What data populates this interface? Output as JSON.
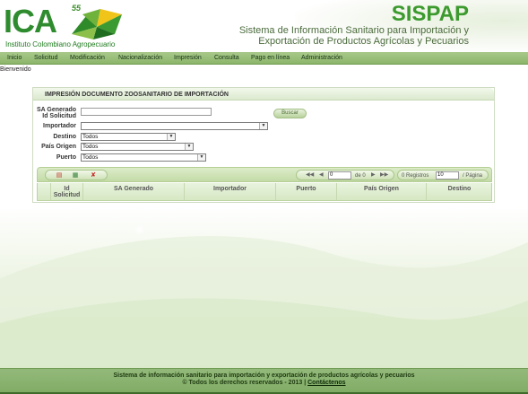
{
  "header": {
    "logo_text": "ICA",
    "logo_badge": "55",
    "org_name": "Instituto Colombiano Agropecuario",
    "app_name": "SISPAP",
    "app_title_line1": "Sistema de Información Sanitario para Importación y",
    "app_title_line2": "Exportación de Productos Agrícolas y Pecuarios"
  },
  "menu": {
    "items": [
      "Inicio",
      "Solicitud",
      "Modificación",
      "Nacionalización",
      "Impresión",
      "Consulta",
      "Pago en línea",
      "Administración"
    ]
  },
  "welcome": "Bienvenido",
  "panel": {
    "title": "IMPRESIÓN DOCUMENTO ZOOSANITARIO DE IMPORTACIÓN",
    "fields": {
      "sa_label_line1": "SA Generado",
      "sa_label_line2": "Id Solicitud",
      "sa_value": "",
      "importador_label": "Importador",
      "importador_value": "",
      "destino_label": "Destino",
      "destino_value": "Todos",
      "pais_label": "País Origen",
      "pais_value": "Todos",
      "puerto_label": "Puerto",
      "puerto_value": "Todos"
    },
    "buscar_label": "Buscar",
    "pager": {
      "page_value": "0",
      "of_text": "de 0",
      "records_text": "0 Registros",
      "page_size_value": "10",
      "per_page_text": "/ Página"
    },
    "columns": {
      "id_line1": "Id",
      "id_line2": "Solicitud",
      "sa": "SA Generado",
      "importador": "Importador",
      "puerto": "Puerto",
      "pais": "País Origen",
      "destino": "Destino"
    }
  },
  "footer": {
    "line1": "Sistema de información sanitario para importación y exportación de productos agrícolas y pecuarios",
    "line2": "© Todos los derechos reservados - 2013 |",
    "contact_link": "Contáctenos"
  },
  "colors": {
    "brand_green": "#2e8b2e",
    "menu_green": "#8cb56a",
    "footer_green": "#7fab64"
  }
}
